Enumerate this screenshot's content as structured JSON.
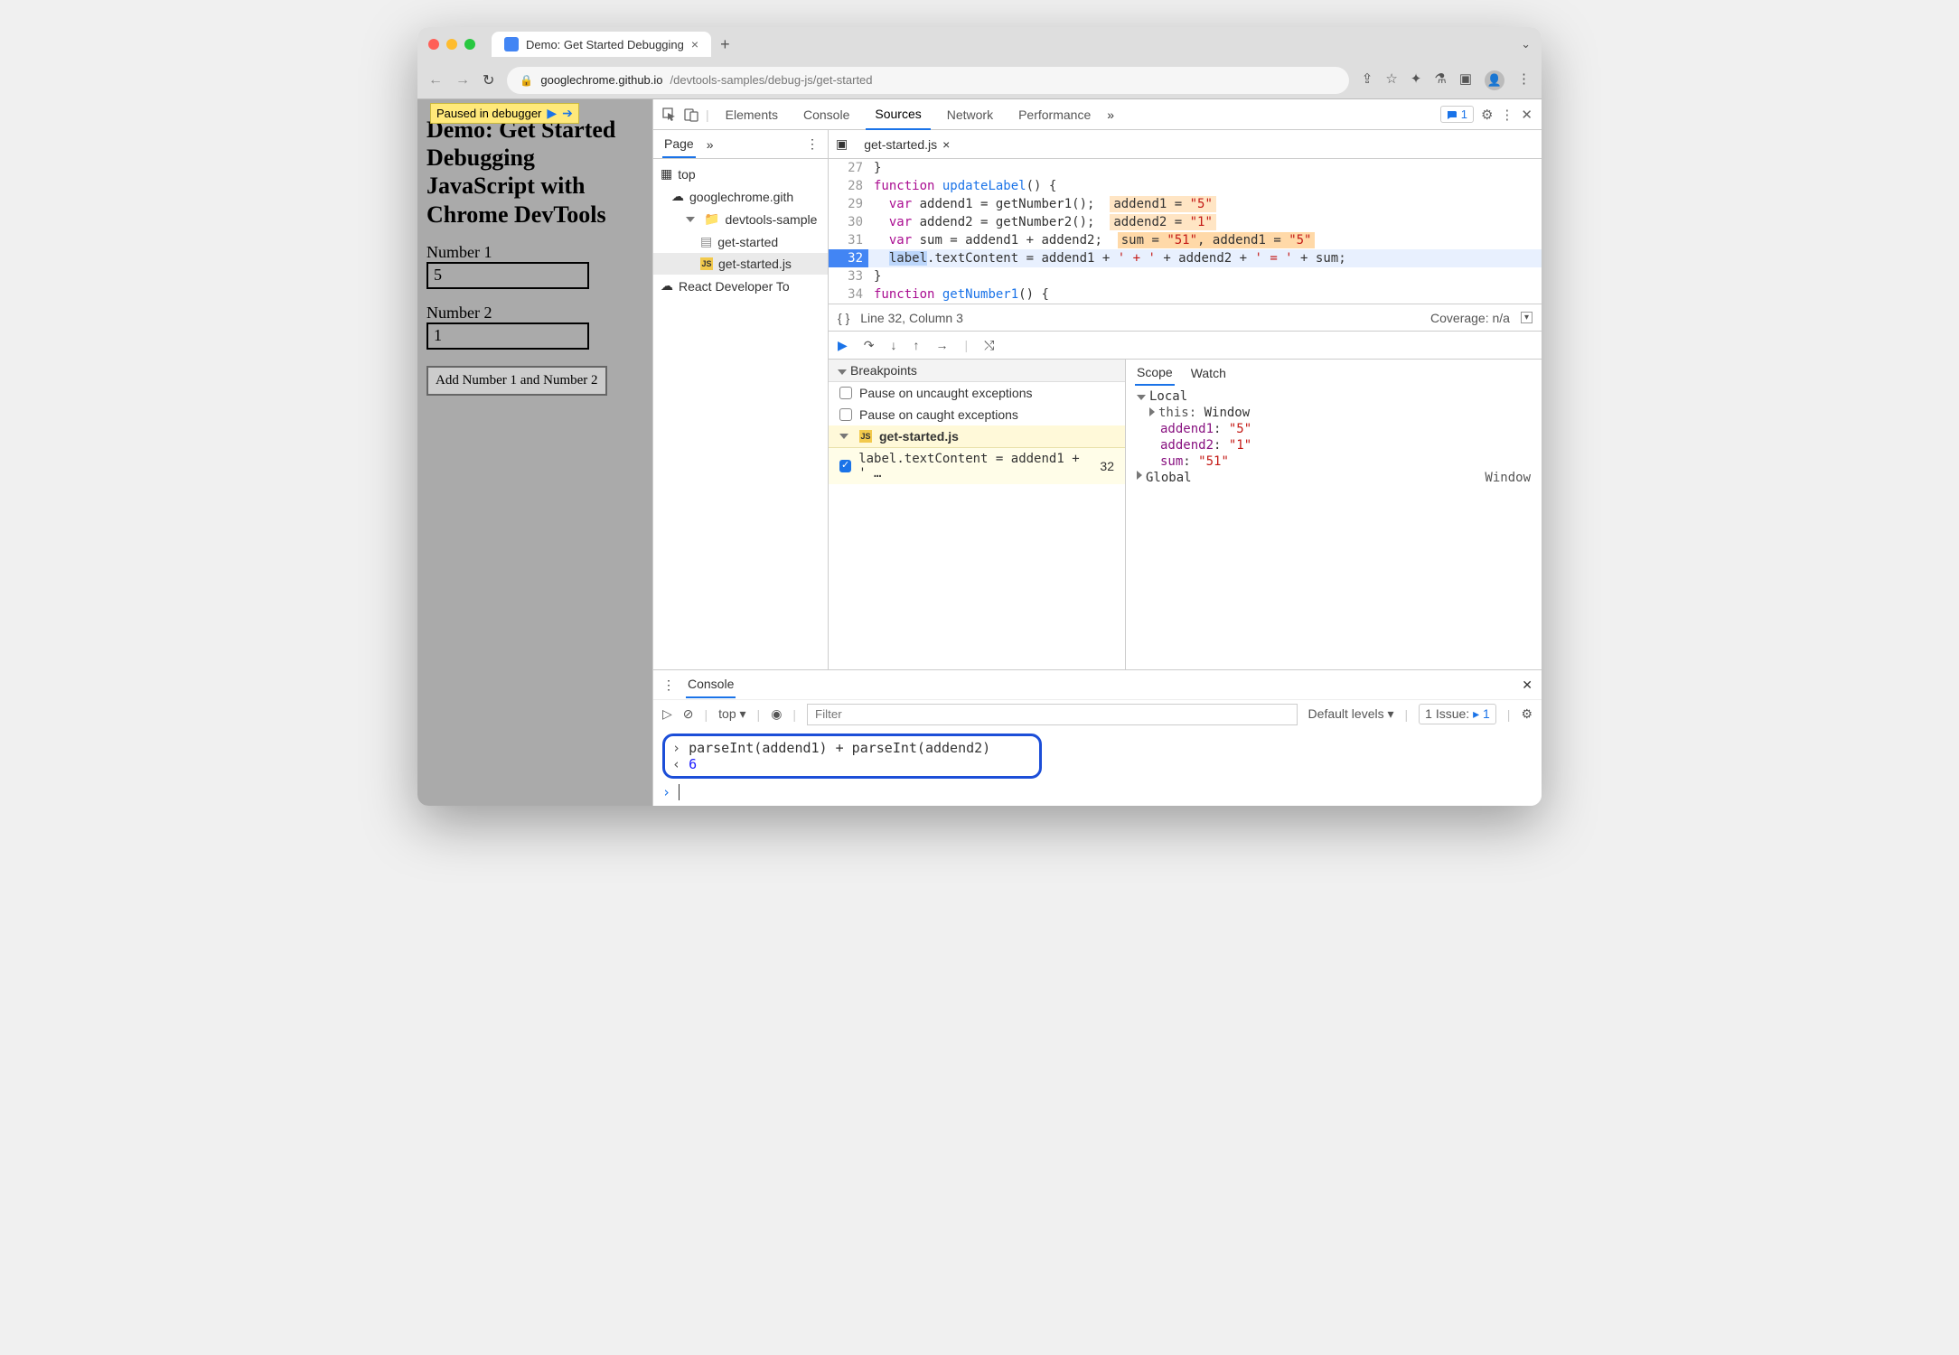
{
  "browser": {
    "tab_title": "Demo: Get Started Debugging",
    "url_host": "googlechrome.github.io",
    "url_path": "/devtools-samples/debug-js/get-started"
  },
  "page": {
    "paused_badge": "Paused in debugger",
    "heading": "Demo: Get Started Debugging JavaScript with Chrome DevTools",
    "label1": "Number 1",
    "value1": "5",
    "label2": "Number 2",
    "value2": "1",
    "button": "Add Number 1 and Number 2"
  },
  "devtools": {
    "tabs": [
      "Elements",
      "Console",
      "Sources",
      "Network",
      "Performance"
    ],
    "active_tab": "Sources",
    "issues": "1",
    "nav": {
      "page_tab": "Page",
      "top": "top",
      "domain": "googlechrome.gith",
      "folder": "devtools-sample",
      "file1": "get-started",
      "file2": "get-started.js",
      "ext": "React Developer To"
    },
    "file_tab": "get-started.js",
    "code": {
      "lines": [
        {
          "n": 27,
          "html": "}"
        },
        {
          "n": 28,
          "html": "<span class='kw'>function</span> <span class='fn'>updateLabel</span>() {"
        },
        {
          "n": 29,
          "html": "  <span class='kw'>var</span> addend1 = getNumber1();  <span class='hint'>addend1 = <span class='str'>\"5\"</span></span>"
        },
        {
          "n": 30,
          "html": "  <span class='kw'>var</span> addend2 = getNumber2();  <span class='hint'>addend2 = <span class='str'>\"1\"</span></span>"
        },
        {
          "n": 31,
          "html": "  <span class='kw'>var</span> sum = addend1 + addend2;  <span class='hint2'>sum = <span class='str'>\"51\"</span>, addend1 = <span class='str'>\"5\"</span></span>"
        },
        {
          "n": 32,
          "cur": true,
          "html": "  <span class='sel-text'>label</span>.textContent = addend1 + <span class='str'>' + '</span> + addend2 + <span class='str'>' = '</span> + sum;"
        },
        {
          "n": 33,
          "html": "}"
        },
        {
          "n": 34,
          "html": "<span class='kw'>function</span> <span class='fn'>getNumber1</span>() {"
        }
      ]
    },
    "status": {
      "pos": "Line 32, Column 3",
      "coverage": "Coverage: n/a"
    },
    "breakpoints": {
      "header": "Breakpoints",
      "opt1": "Pause on uncaught exceptions",
      "opt2": "Pause on caught exceptions",
      "file": "get-started.js",
      "bp_text": "label.textContent = addend1 + ' …",
      "bp_line": "32"
    },
    "scope": {
      "tabs": [
        "Scope",
        "Watch"
      ],
      "local": "Local",
      "this_label": "this:",
      "this_val": "Window",
      "vars": [
        {
          "k": "addend1",
          "v": "\"5\""
        },
        {
          "k": "addend2",
          "v": "\"1\""
        },
        {
          "k": "sum",
          "v": "\"51\""
        }
      ],
      "global": "Global",
      "global_val": "Window"
    }
  },
  "console": {
    "title": "Console",
    "context": "top",
    "filter_ph": "Filter",
    "levels": "Default levels",
    "issue_text": "1 Issue:",
    "issue_count": "1",
    "input": "parseInt(addend1) + parseInt(addend2)",
    "output": "6"
  }
}
